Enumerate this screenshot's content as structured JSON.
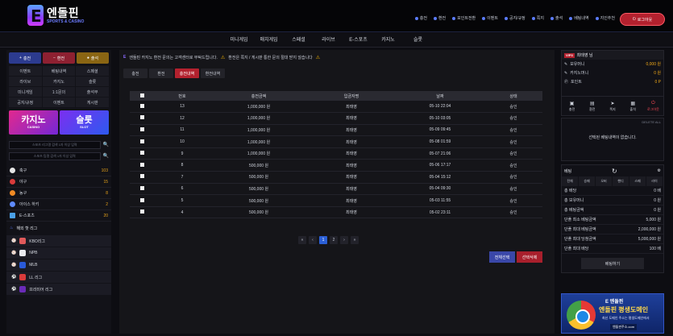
{
  "header": {
    "logo_title": "엔돌핀",
    "logo_sub": "SPORTS & CASINO",
    "links": [
      "충전",
      "환전",
      "포인트전환",
      "이벤트",
      "공지/규정",
      "쪽지",
      "출석",
      "베팅내역",
      "지인추천"
    ],
    "logout": "로그아웃"
  },
  "mainnav": [
    "미니게임",
    "매치게임",
    "스페셜",
    "라이브",
    "E-스포츠",
    "카지노",
    "슬롯"
  ],
  "left": {
    "buttons": [
      "충전",
      "환전",
      "출석"
    ],
    "grid": [
      "이벤트",
      "베팅내역",
      "스페셜",
      "라이브",
      "카지노",
      "슬롯",
      "미니게임",
      "1:1문의",
      "출석부",
      "공지/규정",
      "이벤트",
      "게시판"
    ],
    "banner_casino": {
      "big": "카지노",
      "small": "CASINO"
    },
    "banner_slot": {
      "big": "슬롯",
      "small": "SLOT"
    },
    "search1_placeholder": "스포츠 리그명 검색 1자 이상 입력",
    "search2_placeholder": "스포츠 팀명 검색 1자 이상 입력",
    "sports": [
      {
        "label": "축구",
        "count": "103",
        "color": "#e6e6e6"
      },
      {
        "label": "야구",
        "count": "15",
        "color": "#d93b3b"
      },
      {
        "label": "농구",
        "count": "8",
        "color": "#f08a24"
      },
      {
        "label": "아이스 하키",
        "count": "2",
        "color": "#5f8bff"
      },
      {
        "label": "E-스포츠",
        "count": "20",
        "color": "#4aa0e6"
      }
    ],
    "hot_league_title": "해외 핫 리그",
    "leagues": [
      {
        "label": "KBO리그",
        "color": "#e05a5a"
      },
      {
        "label": "NPB",
        "color": "#e9eaee"
      },
      {
        "label": "MLB",
        "color": "#2a5ad8"
      },
      {
        "label": "LL 리그",
        "color": "#d93b3b"
      },
      {
        "label": "프리미어 리그",
        "color": "#6a2bb8"
      }
    ]
  },
  "center": {
    "notice": "엔돌핀 카지노 환전 문의는 고객센터로 부탁드립니다.",
    "notice_warn": "환전은 쪽지 / 게시판 통한 문의 절대 받지 않습니다",
    "tabs": [
      "충전",
      "환전",
      "충전내역",
      "환전내역"
    ],
    "active_tab": "충전내역",
    "columns": [
      "",
      "번호",
      "충전금액",
      "입금자명",
      "날짜",
      "상태"
    ],
    "rows": [
      {
        "no": "13",
        "amount": "1,000,000 원",
        "name": "최태영",
        "date": "05-10 22:04",
        "status": "승인"
      },
      {
        "no": "12",
        "amount": "1,000,000 원",
        "name": "최태영",
        "date": "05-10 03:05",
        "status": "승인"
      },
      {
        "no": "11",
        "amount": "1,000,000 원",
        "name": "최태영",
        "date": "05-09 09:45",
        "status": "승인"
      },
      {
        "no": "10",
        "amount": "1,000,000 원",
        "name": "최태영",
        "date": "05-08 01:59",
        "status": "승인"
      },
      {
        "no": "9",
        "amount": "1,000,000 원",
        "name": "최태영",
        "date": "05-07 21:06",
        "status": "승인"
      },
      {
        "no": "8",
        "amount": "500,000 원",
        "name": "최태영",
        "date": "05-06 17:17",
        "status": "승인"
      },
      {
        "no": "7",
        "amount": "500,000 원",
        "name": "최태영",
        "date": "05-04 15:12",
        "status": "승인"
      },
      {
        "no": "6",
        "amount": "500,000 원",
        "name": "최태영",
        "date": "05-04 09:30",
        "status": "승인"
      },
      {
        "no": "5",
        "amount": "500,000 원",
        "name": "최태영",
        "date": "05-03 11:55",
        "status": "승인"
      },
      {
        "no": "4",
        "amount": "500,000 원",
        "name": "최태영",
        "date": "05-02 23:11",
        "status": "승인"
      }
    ],
    "pager": [
      "«",
      "‹",
      "1",
      "2",
      "›",
      "»"
    ],
    "active_page": "1",
    "select_all": "전체선택",
    "delete_selected": "선택삭제"
  },
  "right": {
    "vip": "VIP3",
    "username": "최태영 님",
    "rows": [
      {
        "k": "보유머니",
        "v": "0,000 원"
      },
      {
        "k": "카지노머니",
        "v": "0 원"
      },
      {
        "k": "포인트",
        "v": "0 P"
      }
    ],
    "icons": [
      "충전",
      "환전",
      "쪽지",
      "출석",
      "로그아웃"
    ],
    "msg_hint": "DELETE ALL",
    "msg": "선택된 베팅내역이 없습니다.",
    "cart_title": "베팅",
    "cart_tabs": [
      "전체",
      "승패",
      "오버",
      "핸디",
      "스페",
      "라이"
    ],
    "cart_rows": [
      {
        "k": "총 배당",
        "v": "0 배"
      },
      {
        "k": "총 보유머니",
        "v": "0 원"
      },
      {
        "k": "총 베팅금액",
        "v": "0 원"
      },
      {
        "k": "단폴 최소 베팅금액",
        "v": "5,000 원"
      },
      {
        "k": "단폴 최대 베팅금액",
        "v": "2,000,000 원"
      },
      {
        "k": "단폴 최대 당첨금액",
        "v": "5,000,000 원"
      },
      {
        "k": "단폴 최대 배당",
        "v": "100 배"
      }
    ],
    "bet_button": "베팅하기",
    "ad": {
      "t1": "E 엔돌핀",
      "t2": "엔돌핀 평생도메인",
      "t3": "최신 도메인 주소는 평생도메인에서",
      "t4": "엔돌핀주소.com"
    }
  }
}
